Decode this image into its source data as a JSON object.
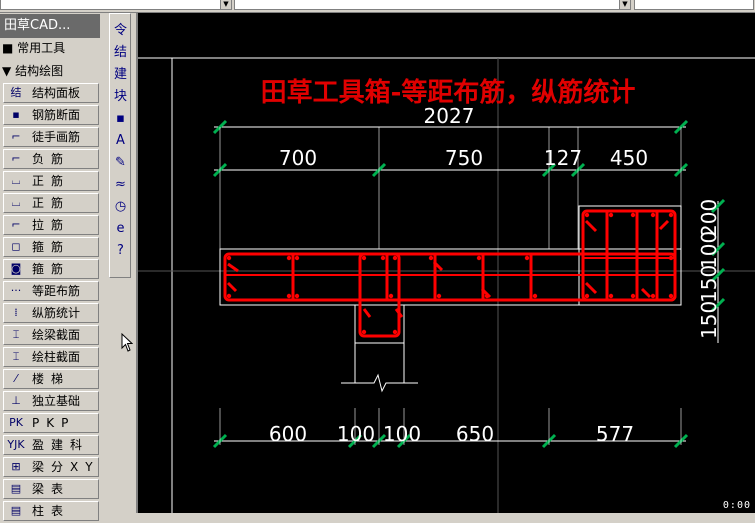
{
  "panel": {
    "title": "田草CAD...",
    "sections": [
      {
        "icon": "■",
        "label": "常用工具"
      },
      {
        "icon": "▼",
        "label": "结构绘图"
      }
    ],
    "tools": [
      {
        "icon": "结",
        "label": "结构面板",
        "name": "tool-structure-panel"
      },
      {
        "icon": "▪",
        "label": "钢筋断面",
        "name": "tool-rebar-section"
      },
      {
        "icon": "⌐",
        "label": "徒手画筋",
        "name": "tool-freehand-rebar"
      },
      {
        "icon": "⌐",
        "label": "负筋",
        "name": "tool-negative-rebar",
        "wide": true
      },
      {
        "icon": "⌴",
        "label": "正筋",
        "name": "tool-positive-rebar-1",
        "wide": true
      },
      {
        "icon": "⌴",
        "label": "正筋",
        "name": "tool-positive-rebar-2",
        "wide": true
      },
      {
        "icon": "⌐",
        "label": "拉筋",
        "name": "tool-tie-rebar",
        "wide": true
      },
      {
        "icon": "◻",
        "label": "箍筋",
        "name": "tool-stirrup-1",
        "wide": true
      },
      {
        "icon": "◙",
        "label": "箍筋",
        "name": "tool-stirrup-2",
        "wide": true
      },
      {
        "icon": "···",
        "label": "等距布筋",
        "name": "tool-equal-spacing-rebar"
      },
      {
        "icon": "⁞",
        "label": "纵筋统计",
        "name": "tool-longitudinal-rebar-stats"
      },
      {
        "icon": "⌶",
        "label": "绘梁截面",
        "name": "tool-draw-beam-section"
      },
      {
        "icon": "⌶",
        "label": "绘柱截面",
        "name": "tool-draw-column-section"
      },
      {
        "icon": "⁄",
        "label": "楼梯",
        "name": "tool-stair",
        "wide": true
      },
      {
        "icon": "⊥",
        "label": "独立基础",
        "name": "tool-isolated-foundation"
      },
      {
        "icon": "PK",
        "label": "PKP",
        "name": "tool-pkp",
        "wide": true
      },
      {
        "icon": "YJK",
        "label": "盈建科",
        "name": "tool-yjk",
        "wide": true
      },
      {
        "icon": "⊞",
        "label": "梁分XY",
        "name": "tool-beam-split-xy",
        "wide": true
      },
      {
        "icon": "▤",
        "label": "梁表",
        "name": "tool-beam-table",
        "wide": true
      },
      {
        "icon": "▤",
        "label": "柱表",
        "name": "tool-column-table",
        "wide": true
      }
    ]
  },
  "icon_strip": [
    {
      "glyph": "令",
      "name": "command-icon"
    },
    {
      "glyph": "结",
      "name": "structure-icon"
    },
    {
      "glyph": "建",
      "name": "architecture-icon"
    },
    {
      "glyph": "块",
      "name": "block-icon"
    },
    {
      "glyph": "▪",
      "name": "point-icon"
    },
    {
      "glyph": "A",
      "name": "text-icon"
    },
    {
      "glyph": "✎",
      "name": "edit-icon"
    },
    {
      "glyph": "≈",
      "name": "hatch-icon"
    },
    {
      "glyph": "◷",
      "name": "clock-icon"
    },
    {
      "glyph": "e",
      "name": "browser-icon"
    },
    {
      "glyph": "?",
      "name": "help-icon"
    }
  ],
  "drawing": {
    "title": "田草工具箱-等距布筋，纵筋统计",
    "dim_total": "2027",
    "dims_top": [
      "700",
      "750",
      "127",
      "450"
    ],
    "dims_bottom": [
      "600",
      "100",
      "100",
      "650",
      "577"
    ],
    "dims_right": [
      "150",
      "150",
      "100",
      "200"
    ],
    "colors": {
      "title": "#e00000",
      "rebar": "#ff0000",
      "dim_tick": "#00b050",
      "outline": "#ffffff",
      "text": "#ffffff"
    }
  },
  "status": {
    "timer": "0:00"
  }
}
